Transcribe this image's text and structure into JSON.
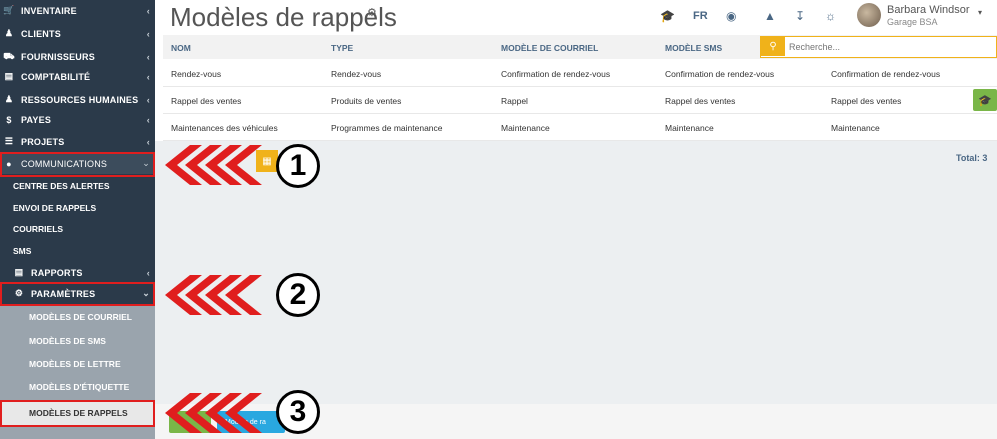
{
  "sidebar": {
    "items": [
      {
        "label": "INVENTAIRE",
        "icon": "cart-icon"
      },
      {
        "label": "CLIENTS",
        "icon": "users-icon"
      },
      {
        "label": "FOURNISSEURS",
        "icon": "truck-icon"
      },
      {
        "label": "COMPTABILITÉ",
        "icon": "chart-icon"
      },
      {
        "label": "RESSOURCES HUMAINES",
        "icon": "user-icon"
      },
      {
        "label": "PAYES",
        "icon": "dollar-icon"
      },
      {
        "label": "PROJETS",
        "icon": "list-icon"
      },
      {
        "label": "COMMUNICATIONS",
        "icon": "comments-icon"
      }
    ],
    "comm_sub": [
      "CENTRE DES ALERTES",
      "ENVOI DE RAPPELS",
      "COURRIELS",
      "SMS"
    ],
    "rapports": "RAPPORTS",
    "parametres": "PARAMÈTRES",
    "param_sub": [
      "MODÈLES DE COURRIEL",
      "MODÈLES DE SMS",
      "MODÈLES DE LETTRE",
      "MODÈLES D'ÉTIQUETTE",
      "MODÈLES DE RAPPELS"
    ]
  },
  "header": {
    "title": "Modèles de rappels",
    "lang": "FR",
    "user_name": "Barbara Windsor",
    "user_company": "Garage BSA"
  },
  "table": {
    "columns": [
      "NOM",
      "TYPE",
      "MODÈLE DE COURRIEL",
      "MODÈLE SMS"
    ],
    "search_placeholder": "Recherche...",
    "rows": [
      [
        "Rendez-vous",
        "Rendez-vous",
        "Confirmation de rendez-vous",
        "Confirmation de rendez-vous",
        "Confirmation de rendez-vous"
      ],
      [
        "Rappel des ventes",
        "Produits de ventes",
        "Rappel",
        "Rappel des ventes",
        "Rappel des ventes"
      ],
      [
        "Maintenances des véhicules",
        "Programmes de maintenance",
        "Maintenance",
        "Maintenance",
        "Maintenance"
      ]
    ],
    "total": "Total: 3"
  },
  "bottom": {
    "blue_button": "Modèle de ra"
  },
  "annotations": [
    "1",
    "2",
    "3"
  ],
  "colors": {
    "sidebar": "#2b3a4a",
    "accent": "#f0b21a",
    "red": "#e01e1e",
    "green": "#7ab648",
    "blue": "#29a8e0"
  }
}
